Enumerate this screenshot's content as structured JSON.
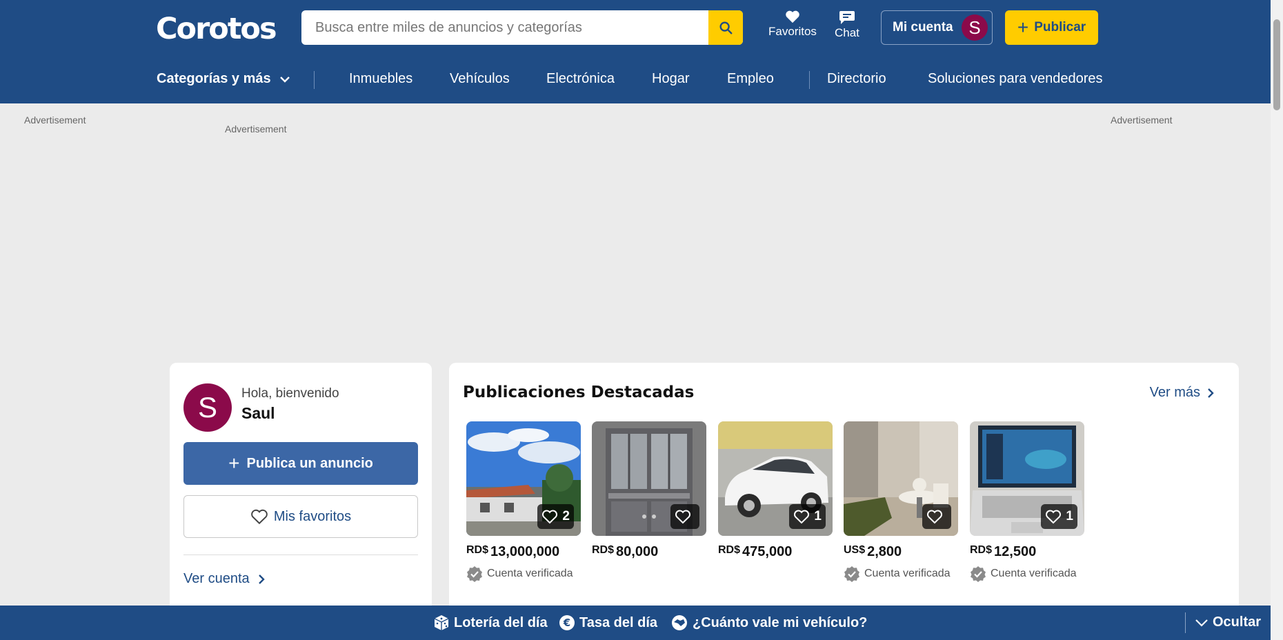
{
  "header": {
    "logo": "Corotos",
    "search_placeholder": "Busca entre miles de anuncios y categorías",
    "favoritos_label": "Favoritos",
    "chat_label": "Chat",
    "account_label": "Mi cuenta",
    "account_initial": "S",
    "publish_label": "Publicar"
  },
  "nav": {
    "categories_label": "Categorías y más",
    "items": [
      "Inmuebles",
      "Vehículos",
      "Electrónica",
      "Hogar",
      "Empleo"
    ],
    "directorio": "Directorio",
    "soluciones": "Soluciones para vendedores"
  },
  "ads": {
    "left": "Advertisement",
    "center": "Advertisement",
    "right": "Advertisement"
  },
  "user_card": {
    "initial": "S",
    "greeting": "Hola, bienvenido",
    "name": "Saul",
    "publish_label": "Publica un anuncio",
    "favorites_label": "Mis favoritos",
    "account_link": "Ver cuenta"
  },
  "featured": {
    "title": "Publicaciones Destacadas",
    "see_more": "Ver más",
    "listings": [
      {
        "currency": "RD$",
        "price": "13,000,000",
        "favorites": "2",
        "verified": "Cuenta verificada"
      },
      {
        "currency": "RD$",
        "price": "80,000",
        "favorites": "",
        "verified": ""
      },
      {
        "currency": "RD$",
        "price": "475,000",
        "favorites": "1",
        "verified": ""
      },
      {
        "currency": "US$",
        "price": "2,800",
        "favorites": "",
        "verified": "Cuenta verificada"
      },
      {
        "currency": "RD$",
        "price": "12,500",
        "favorites": "1",
        "verified": "Cuenta verificada"
      }
    ]
  },
  "bottom_bar": {
    "loteria": "Lotería del día",
    "tasa": "Tasa del día",
    "vehiculo": "¿Cuánto vale mi vehículo?",
    "hide": "Ocultar"
  },
  "colors": {
    "brand_blue": "#1f4c85",
    "accent_yellow": "#ffcc00",
    "avatar": "#8b0a4a",
    "button_blue": "#3c67a6"
  }
}
